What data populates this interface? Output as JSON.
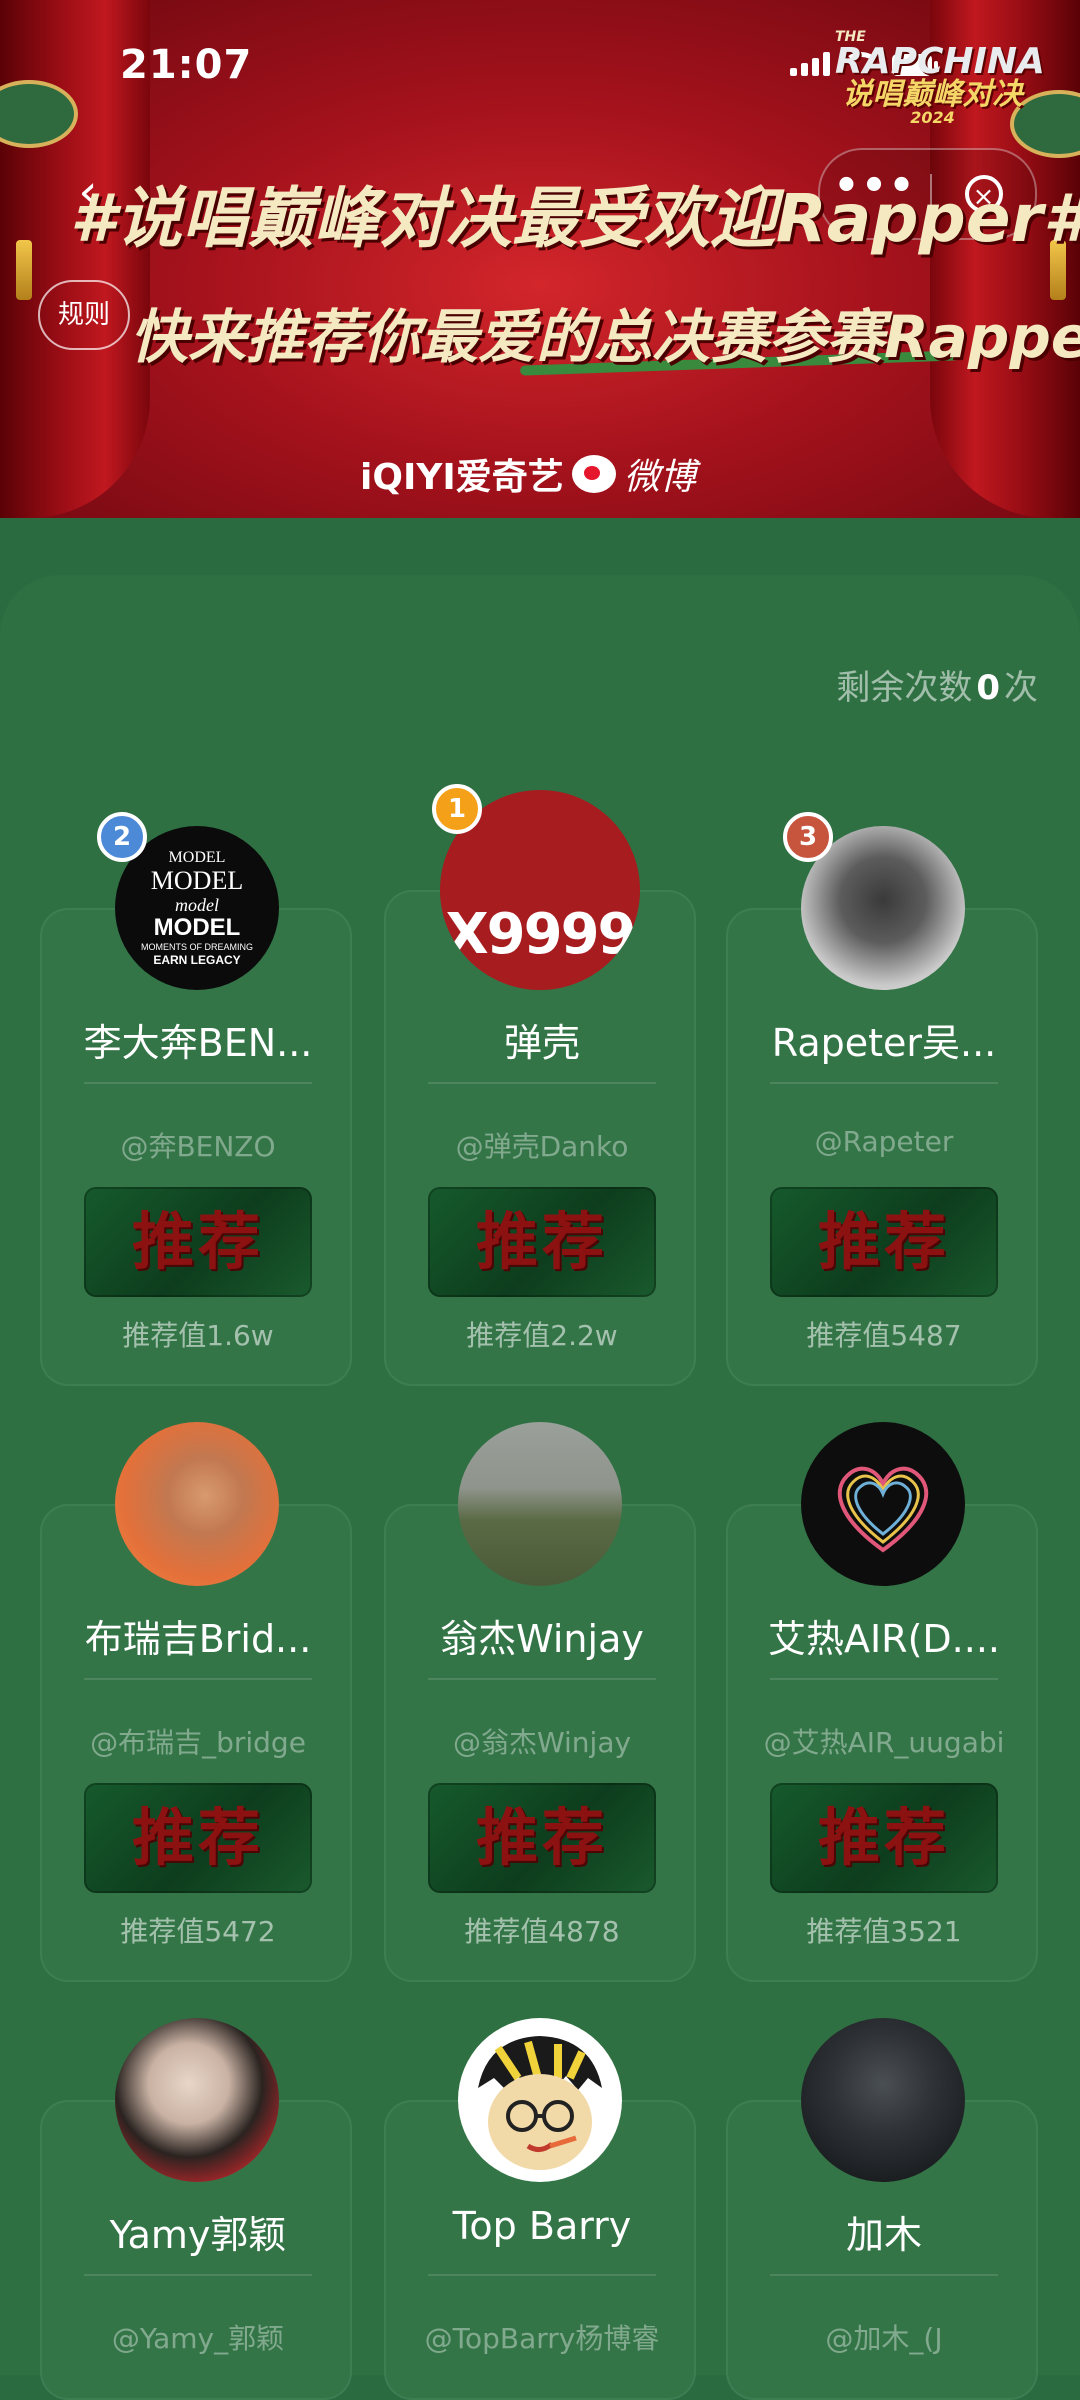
{
  "status_bar": {
    "time": "21:07"
  },
  "banner": {
    "show_logo": {
      "line1": "THE",
      "line2": "RAPCHINA",
      "line3": "说唱巅峰对决",
      "line4": "2024"
    },
    "headline": "#说唱巅峰对决最受欢迎Rapper#",
    "subline": "快来推荐你最爱的总决赛参赛Rapper!",
    "rules_label": "规则",
    "sponsor_iqiyi": "iQIYI爱奇艺",
    "sponsor_weibo": "微博",
    "more_label": "•••",
    "close_label": "×",
    "back_label": "‹"
  },
  "remaining": {
    "prefix": "剩余次数",
    "count": "0",
    "suffix": "次"
  },
  "button_label": "推荐",
  "cards": [
    {
      "name": "李大奔BEN...",
      "handle": "@奔BENZO",
      "value": "推荐值1.6w",
      "rank": "2"
    },
    {
      "name": "弹壳",
      "handle": "@弹壳Danko",
      "value": "推荐值2.2w",
      "rank": "1",
      "avatar_text": "X9999"
    },
    {
      "name": "Rapeter吴...",
      "handle": "@Rapeter",
      "value": "推荐值5487",
      "rank": "3"
    },
    {
      "name": "布瑞吉Brid...",
      "handle": "@布瑞吉_bridge",
      "value": "推荐值5472"
    },
    {
      "name": "翁杰Winjay",
      "handle": "@翁杰Winjay",
      "value": "推荐值4878"
    },
    {
      "name": "艾热AIR(D....",
      "handle": "@艾热AIR_uugabi",
      "value": "推荐值3521"
    },
    {
      "name": "Yamy郭颖",
      "handle": "@Yamy_郭颖"
    },
    {
      "name": "Top Barry",
      "handle": "@TopBarry杨博睿"
    },
    {
      "name": "加木",
      "handle": "@加木_(J"
    }
  ],
  "model_cover": {
    "l1": "MODEL",
    "l2": "MODEL",
    "l3": "model",
    "l4": "MODEL",
    "l5": "MOMENTS OF DREAMING",
    "l6": "EARN LEGACY"
  }
}
